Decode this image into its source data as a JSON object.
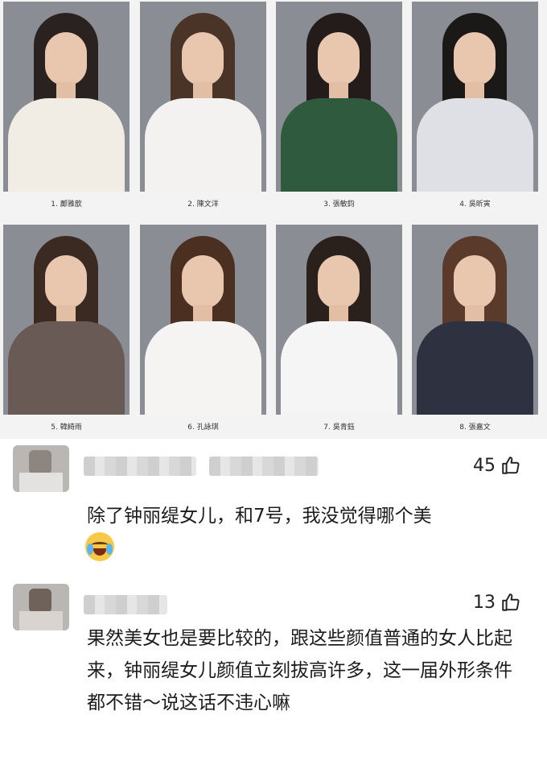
{
  "contestants": [
    {
      "caption": "1. 鄺雅歆",
      "hair": "#2a2220",
      "outfit": "#f1ece4"
    },
    {
      "caption": "2. 陳文洋",
      "hair": "#4a3428",
      "outfit": "#f4f2f0"
    },
    {
      "caption": "3. 張敏鈞",
      "hair": "#231c1a",
      "outfit": "#2f5a3e"
    },
    {
      "caption": "4. 吳昕寅",
      "hair": "#1b1818",
      "outfit": "#dfe0e6"
    },
    {
      "caption": "5. 韓綺雨",
      "hair": "#3a2a22",
      "outfit": "#6a5a55"
    },
    {
      "caption": "6. 孔詠琪",
      "hair": "#4b3022",
      "outfit": "#f6f4f2"
    },
    {
      "caption": "7. 吳青鈺",
      "hair": "#2a211d",
      "outfit": "#f5f5f5"
    },
    {
      "caption": "8. 張嘉文",
      "hair": "#5a3a2a",
      "outfit": "#2d3140"
    }
  ],
  "comments": [
    {
      "likes": "45",
      "text": "除了钟丽缇女儿，和7号，我没觉得哪个美",
      "emoji": "loudly-crying-face"
    },
    {
      "likes": "13",
      "text": "果然美女也是要比较的，跟这些颜值普通的女人比起来，钟丽缇女儿颜值立刻拔高许多，这一届外形条件都不错～说这话不违心嘛"
    }
  ]
}
